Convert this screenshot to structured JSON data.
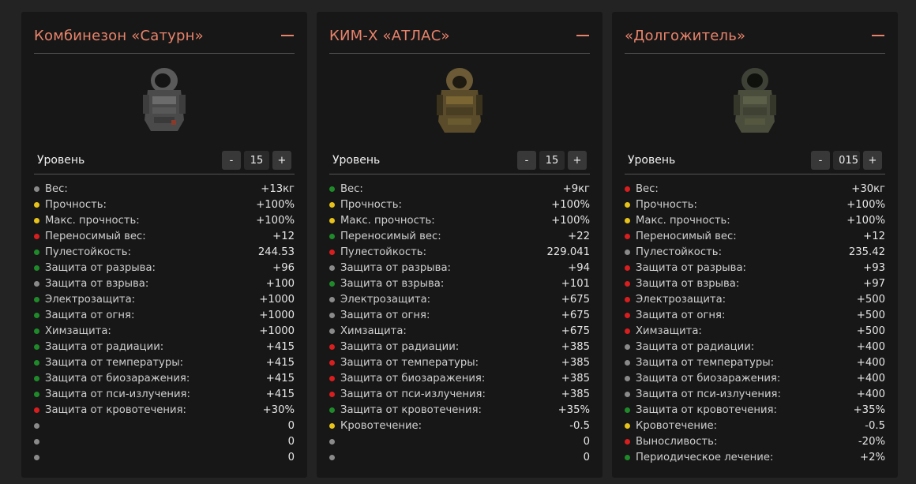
{
  "colors": {
    "green": "#1f8a2a",
    "yellow": "#e6c21a",
    "red": "#d81e1e",
    "gray": "#8a8a8a",
    "title": "#e8836b"
  },
  "cards": [
    {
      "title": "Комбинезон «Сатурн»",
      "level_label": "Уровень",
      "level_value": "15",
      "minus_label": "-",
      "plus_label": "+",
      "image_icon": "saturn-suit-icon",
      "stats": [
        {
          "name": "Вес:",
          "value": "+13кг",
          "status": "gray"
        },
        {
          "name": "Прочность:",
          "value": "+100%",
          "status": "yellow"
        },
        {
          "name": "Макс. прочность:",
          "value": "+100%",
          "status": "yellow"
        },
        {
          "name": "Переносимый вес:",
          "value": "+12",
          "status": "red"
        },
        {
          "name": "Пулестойкость:",
          "value": "244.53",
          "status": "green"
        },
        {
          "name": "Защита от разрыва:",
          "value": "+96",
          "status": "green"
        },
        {
          "name": "Защита от взрыва:",
          "value": "+100",
          "status": "gray"
        },
        {
          "name": "Электрозащита:",
          "value": "+1000",
          "status": "green"
        },
        {
          "name": "Защита от огня:",
          "value": "+1000",
          "status": "green"
        },
        {
          "name": "Химзащита:",
          "value": "+1000",
          "status": "green"
        },
        {
          "name": "Защита от радиации:",
          "value": "+415",
          "status": "green"
        },
        {
          "name": "Защита от температуры:",
          "value": "+415",
          "status": "green"
        },
        {
          "name": "Защита от биозаражения:",
          "value": "+415",
          "status": "green"
        },
        {
          "name": "Защита от пси-излучения:",
          "value": "+415",
          "status": "green"
        },
        {
          "name": "Защита от кровотечения:",
          "value": "+30%",
          "status": "red"
        },
        {
          "name": "",
          "value": "0",
          "status": "gray"
        },
        {
          "name": "",
          "value": "0",
          "status": "gray"
        },
        {
          "name": "",
          "value": "0",
          "status": "gray"
        }
      ]
    },
    {
      "title": "КИМ-Х «АТЛАС»",
      "level_label": "Уровень",
      "level_value": "15",
      "minus_label": "-",
      "plus_label": "+",
      "image_icon": "atlas-suit-icon",
      "stats": [
        {
          "name": "Вес:",
          "value": "+9кг",
          "status": "green"
        },
        {
          "name": "Прочность:",
          "value": "+100%",
          "status": "yellow"
        },
        {
          "name": "Макс. прочность:",
          "value": "+100%",
          "status": "yellow"
        },
        {
          "name": "Переносимый вес:",
          "value": "+22",
          "status": "green"
        },
        {
          "name": "Пулестойкость:",
          "value": "229.041",
          "status": "red"
        },
        {
          "name": "Защита от разрыва:",
          "value": "+94",
          "status": "gray"
        },
        {
          "name": "Защита от взрыва:",
          "value": "+101",
          "status": "green"
        },
        {
          "name": "Электрозащита:",
          "value": "+675",
          "status": "gray"
        },
        {
          "name": "Защита от огня:",
          "value": "+675",
          "status": "gray"
        },
        {
          "name": "Химзащита:",
          "value": "+675",
          "status": "gray"
        },
        {
          "name": "Защита от радиации:",
          "value": "+385",
          "status": "red"
        },
        {
          "name": "Защита от температуры:",
          "value": "+385",
          "status": "red"
        },
        {
          "name": "Защита от биозаражения:",
          "value": "+385",
          "status": "red"
        },
        {
          "name": "Защита от пси-излучения:",
          "value": "+385",
          "status": "red"
        },
        {
          "name": "Защита от кровотечения:",
          "value": "+35%",
          "status": "green"
        },
        {
          "name": "Кровотечение:",
          "value": "-0.5",
          "status": "yellow"
        },
        {
          "name": "",
          "value": "0",
          "status": "gray"
        },
        {
          "name": "",
          "value": "0",
          "status": "gray"
        }
      ]
    },
    {
      "title": "«Долгожитель»",
      "level_label": "Уровень",
      "level_value": "015",
      "minus_label": "-",
      "plus_label": "+",
      "image_icon": "dolgozhitel-suit-icon",
      "stats": [
        {
          "name": "Вес:",
          "value": "+30кг",
          "status": "red"
        },
        {
          "name": "Прочность:",
          "value": "+100%",
          "status": "yellow"
        },
        {
          "name": "Макс. прочность:",
          "value": "+100%",
          "status": "yellow"
        },
        {
          "name": "Переносимый вес:",
          "value": "+12",
          "status": "red"
        },
        {
          "name": "Пулестойкость:",
          "value": "235.42",
          "status": "gray"
        },
        {
          "name": "Защита от разрыва:",
          "value": "+93",
          "status": "red"
        },
        {
          "name": "Защита от взрыва:",
          "value": "+97",
          "status": "red"
        },
        {
          "name": "Электрозащита:",
          "value": "+500",
          "status": "red"
        },
        {
          "name": "Защита от огня:",
          "value": "+500",
          "status": "red"
        },
        {
          "name": "Химзащита:",
          "value": "+500",
          "status": "red"
        },
        {
          "name": "Защита от радиации:",
          "value": "+400",
          "status": "gray"
        },
        {
          "name": "Защита от температуры:",
          "value": "+400",
          "status": "gray"
        },
        {
          "name": "Защита от биозаражения:",
          "value": "+400",
          "status": "gray"
        },
        {
          "name": "Защита от пси-излучения:",
          "value": "+400",
          "status": "gray"
        },
        {
          "name": "Защита от кровотечения:",
          "value": "+35%",
          "status": "green"
        },
        {
          "name": "Кровотечение:",
          "value": "-0.5",
          "status": "yellow"
        },
        {
          "name": "Выносливость:",
          "value": "-20%",
          "status": "red"
        },
        {
          "name": "Периодическое лечение:",
          "value": "+2%",
          "status": "green"
        }
      ]
    }
  ]
}
